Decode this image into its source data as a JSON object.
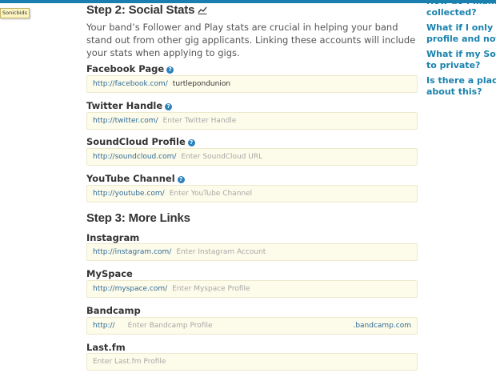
{
  "tooltip": {
    "text": "Sonicbids"
  },
  "step2": {
    "title": "Step 2: Social Stats",
    "intro": "Your band’s Follower and Play stats are crucial in helping your band stand out from other gig applicants. Linking these accounts will include your stats when applying to gigs."
  },
  "facebook": {
    "label": "Facebook Page",
    "prefix": "http://facebook.com/",
    "value": "turtlepondunion"
  },
  "twitter": {
    "label": "Twitter Handle",
    "prefix": "http://twitter.com/",
    "placeholder": "Enter Twitter Handle"
  },
  "soundcloud": {
    "label": "SoundCloud Profile",
    "prefix": "http://soundcloud.com/",
    "placeholder": "Enter SoundCloud URL"
  },
  "youtube": {
    "label": "YouTube Channel",
    "prefix": "http://youtube.com/",
    "placeholder": "Enter YouTube Channel"
  },
  "step3": {
    "title": "Step 3: More Links"
  },
  "instagram": {
    "label": "Instagram",
    "prefix": "http://instagram.com/",
    "placeholder": "Enter Instagram Account"
  },
  "myspace": {
    "label": "MySpace",
    "prefix": "http://myspace.com/",
    "placeholder": "Enter Myspace Profile"
  },
  "bandcamp": {
    "label": "Bandcamp",
    "prefix": "http://",
    "placeholder": "Enter Bandcamp Profile",
    "suffix": ".bandcamp.com"
  },
  "lastfm": {
    "label": "Last.fm",
    "placeholder": "Enter Last.fm Profile"
  },
  "sidebar": {
    "links": [
      {
        "line1": "How do I make",
        "line2": "collected?"
      },
      {
        "line1": "What if I only ha",
        "line2": "profile and not a"
      },
      {
        "line1": "What if my Soun",
        "line2": "to private?"
      },
      {
        "line1": "Is there a place",
        "line2": "about this?"
      }
    ]
  },
  "colors": {
    "accent": "#1a82ad",
    "field_bg": "#fdfbe9",
    "prefix": "#2f6b9a"
  }
}
